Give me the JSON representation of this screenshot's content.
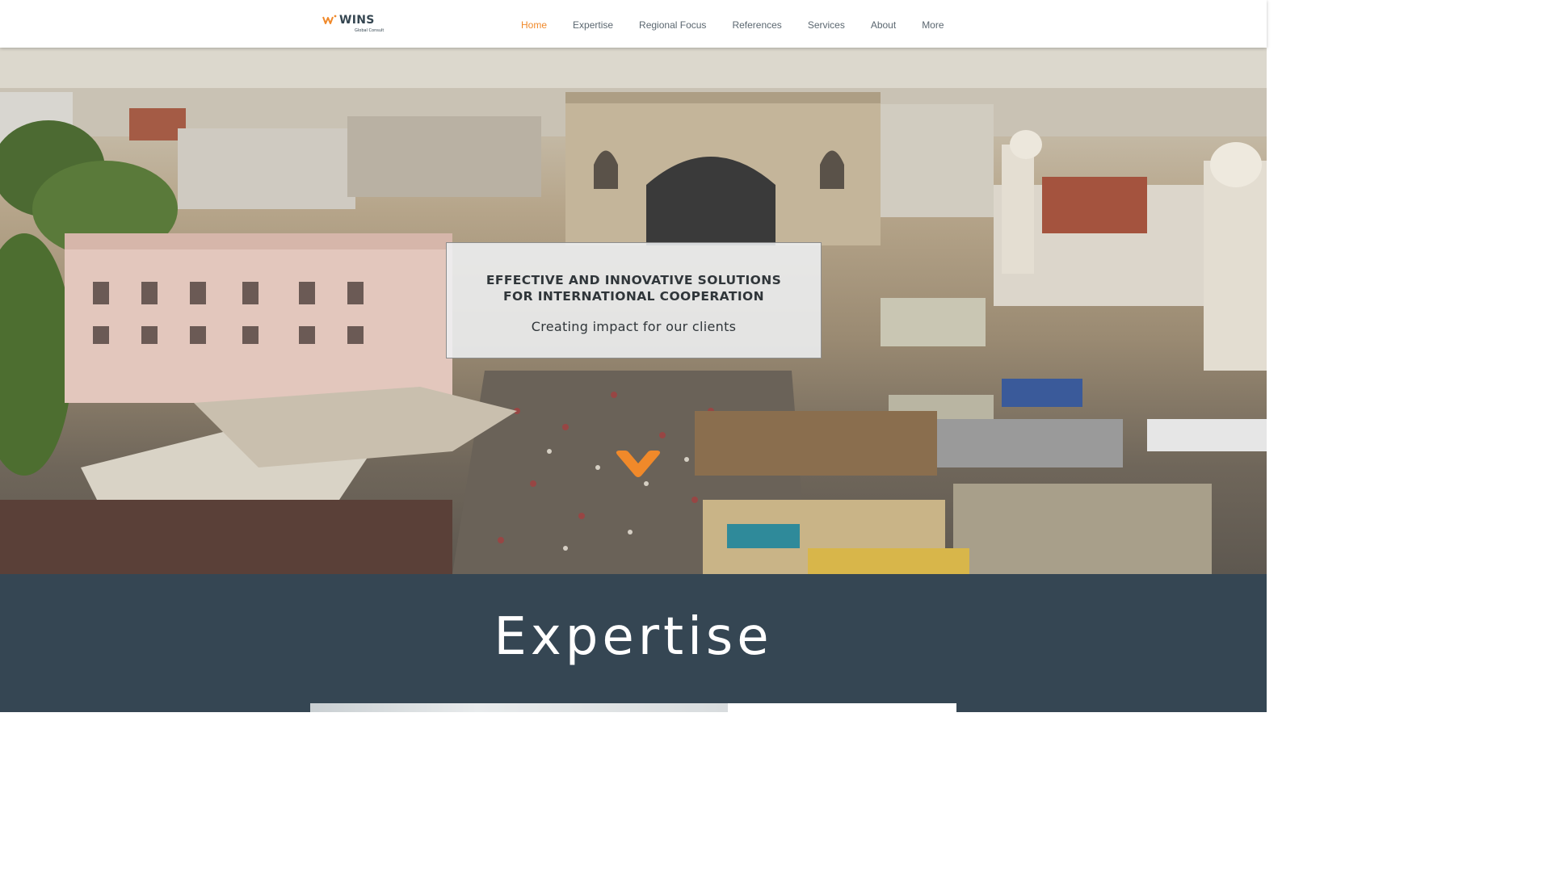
{
  "header": {
    "logo": {
      "brand": "WINS",
      "tagline": "Global Consult",
      "icon": "wins-logo-icon"
    },
    "nav": [
      {
        "label": "Home",
        "active": true
      },
      {
        "label": "Expertise",
        "active": false
      },
      {
        "label": "Regional Focus",
        "active": false
      },
      {
        "label": "References",
        "active": false
      },
      {
        "label": "Services",
        "active": false
      },
      {
        "label": "About",
        "active": false
      },
      {
        "label": "More",
        "active": false
      }
    ]
  },
  "hero": {
    "title_line1": "EFFECTIVE AND INNOVATIVE SOLUTIONS",
    "title_line2": "FOR INTERNATIONAL COOPERATION",
    "subtitle": "Creating impact for our clients",
    "scroll_icon": "chevron-down-icon"
  },
  "expertise": {
    "title": "Expertise"
  },
  "colors": {
    "accent": "#f0892a",
    "nav_text": "#5b6770",
    "section_bg": "#354653",
    "card_text": "#30363a"
  }
}
